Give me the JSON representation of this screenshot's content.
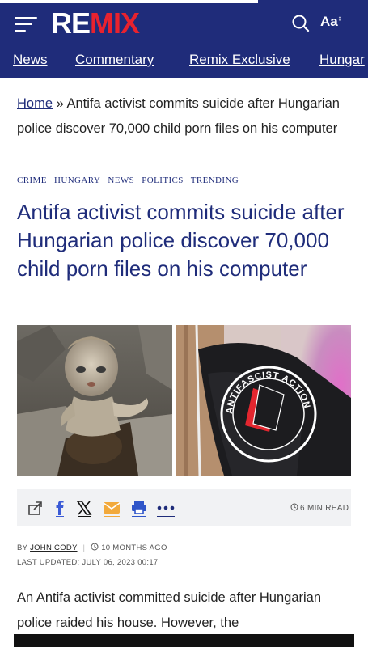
{
  "header": {
    "logo_re": "RE",
    "logo_mix": "MIX",
    "font_toggle": "Aa",
    "font_toggle_mark": "↕",
    "brand_color": "#1f2c7a",
    "logo_accent": "#e8222e",
    "reading_progress": 0.7
  },
  "nav": {
    "items": [
      "News",
      "Commentary",
      "Remix Exclusive",
      "Hungar"
    ]
  },
  "breadcrumb": {
    "home": "Home",
    "separator": "»",
    "current": "Antifa activist commits suicide after Hungarian police discover 70,000 child porn files on his computer"
  },
  "categories": [
    "CRIME",
    "HUNGARY",
    "NEWS",
    "POLITICS",
    "TRENDING"
  ],
  "article": {
    "title": "Antifa activist commits suicide after Hungarian police discover 70,000 child porn files on his computer",
    "flag_text": "ANTIFASCIST ACTION",
    "read_time": "6 MIN READ",
    "byline_prefix": "BY",
    "author": "JOHN CODY",
    "age": "10 MONTHS AGO",
    "last_updated": "LAST UPDATED: JULY 06, 2023 00:17",
    "body": "An Antifa activist committed suicide after Hungarian police raided his house. However, the"
  },
  "share": {
    "icons": [
      "share-icon",
      "facebook-icon",
      "x-icon",
      "email-icon",
      "print-icon",
      "more-icon"
    ]
  }
}
